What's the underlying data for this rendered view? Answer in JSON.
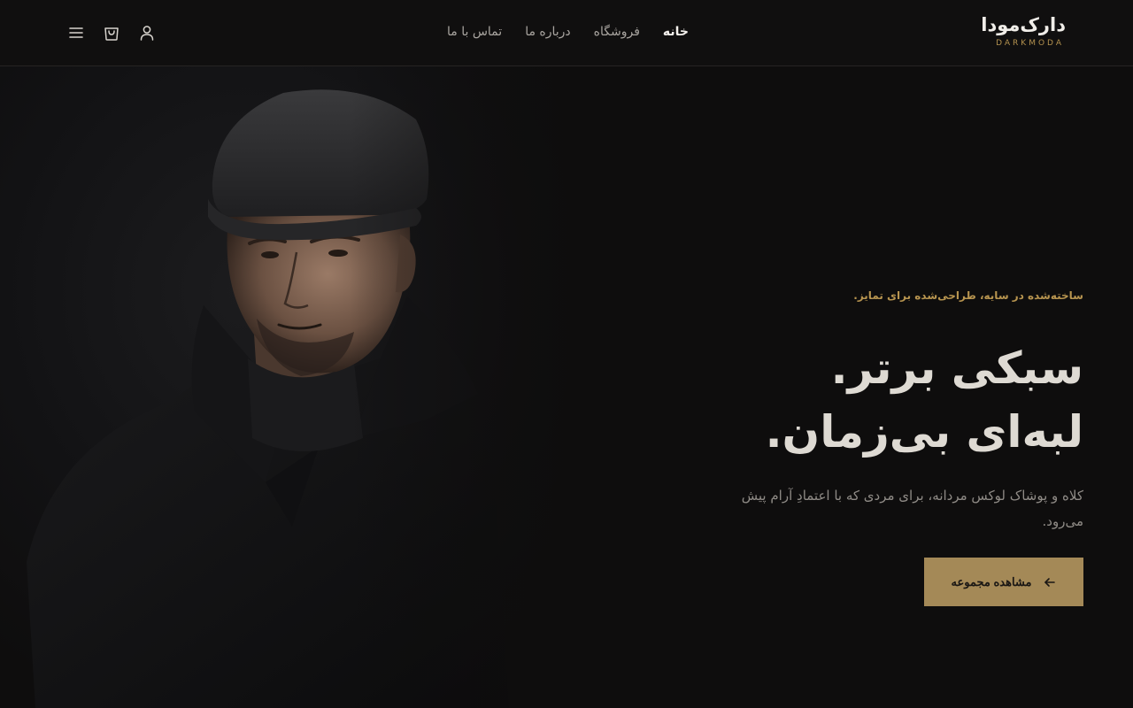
{
  "brand": {
    "name_fa": "دارک‌مودا",
    "name_en": "DARKMODA"
  },
  "nav": {
    "items": [
      {
        "label": "خانه",
        "active": true
      },
      {
        "label": "فروشگاه",
        "active": false
      },
      {
        "label": "درباره ما",
        "active": false
      },
      {
        "label": "تماس با ما",
        "active": false
      }
    ]
  },
  "header_icons": [
    "user-icon",
    "shopping-bag-icon",
    "menu-icon"
  ],
  "hero": {
    "eyebrow": "ساخته‌شده در سایه، طراحی‌شده برای تمایز.",
    "headline_line1": "سبکی برتر.",
    "headline_line2": "لبه‌ای بی‌زمان.",
    "subtitle": "کلاه و پوشاک لوکس مردانه، برای مردی که با اعتمادِ آرام پیش می‌رود.",
    "cta_label": "مشاهده مجموعه",
    "cta_icon": "arrow-left-icon"
  },
  "colors": {
    "background": "#0e0d0d",
    "accent": "#a48957",
    "eyebrow": "#b7944f",
    "headline": "#dedad3"
  }
}
